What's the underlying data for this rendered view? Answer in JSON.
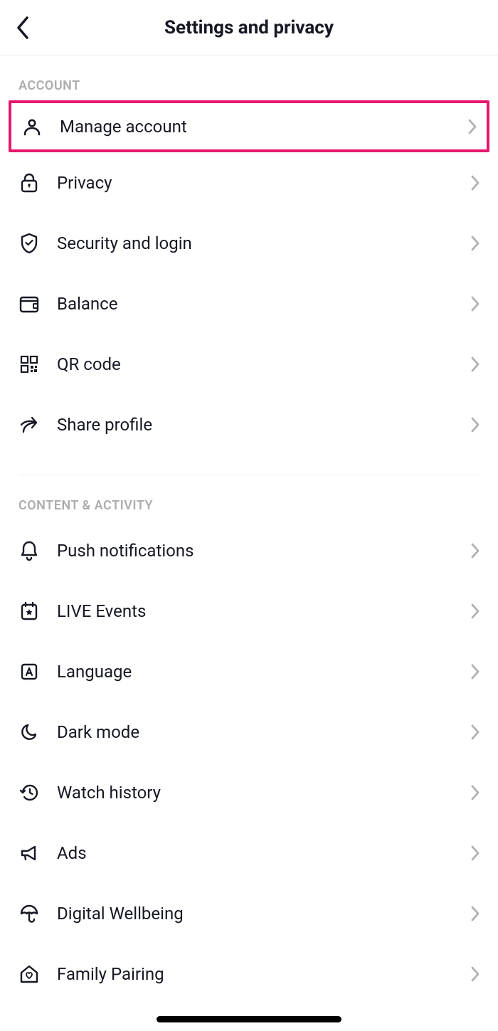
{
  "header": {
    "title": "Settings and privacy"
  },
  "sections": [
    {
      "id": "account",
      "title": "ACCOUNT",
      "items": [
        {
          "id": "manage-account",
          "label": "Manage account",
          "highlighted": true
        },
        {
          "id": "privacy",
          "label": "Privacy"
        },
        {
          "id": "security-login",
          "label": "Security and login"
        },
        {
          "id": "balance",
          "label": "Balance"
        },
        {
          "id": "qr-code",
          "label": "QR code"
        },
        {
          "id": "share-profile",
          "label": "Share profile"
        }
      ]
    },
    {
      "id": "content-activity",
      "title": "CONTENT & ACTIVITY",
      "items": [
        {
          "id": "push-notifications",
          "label": "Push notifications"
        },
        {
          "id": "live-events",
          "label": "LIVE Events"
        },
        {
          "id": "language",
          "label": "Language"
        },
        {
          "id": "dark-mode",
          "label": "Dark mode"
        },
        {
          "id": "watch-history",
          "label": "Watch history"
        },
        {
          "id": "ads",
          "label": "Ads"
        },
        {
          "id": "digital-wellbeing",
          "label": "Digital Wellbeing"
        },
        {
          "id": "family-pairing",
          "label": "Family Pairing"
        }
      ]
    }
  ],
  "colors": {
    "highlight": "#e6186d",
    "text": "#161823",
    "muted": "#adadad",
    "chevron": "#b0b0b4"
  }
}
